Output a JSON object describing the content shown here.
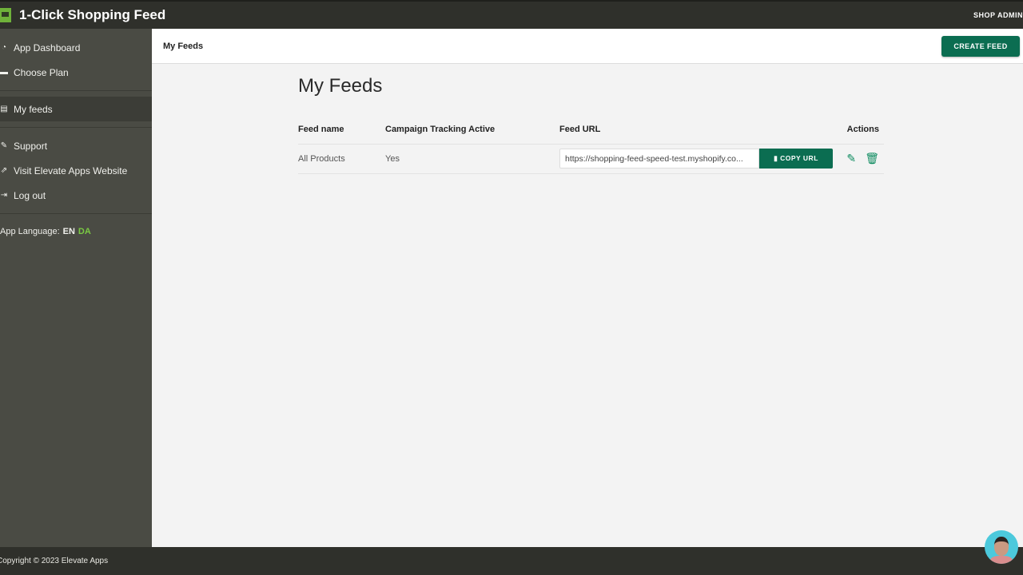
{
  "app": {
    "title": "1-Click Shopping Feed",
    "shop_admin_label": "SHOP ADMIN",
    "logo_icon": "shopping-cart-icon"
  },
  "sidebar": {
    "items": [
      {
        "label": "App Dashboard",
        "icon": "dashboard-icon",
        "glyph": "◔"
      },
      {
        "label": "Choose Plan",
        "icon": "credit-card-icon",
        "glyph": "▬"
      },
      {
        "label": "My feeds",
        "icon": "file-icon",
        "glyph": "▤",
        "active": true
      },
      {
        "label": "Support",
        "icon": "handshake-icon",
        "glyph": "✎"
      },
      {
        "label": "Visit Elevate Apps Website",
        "icon": "external-link-icon",
        "glyph": "⇗"
      },
      {
        "label": "Log out",
        "icon": "sign-out-icon",
        "glyph": "⇥"
      }
    ],
    "language": {
      "label": "App Language:",
      "current": "EN",
      "alternate": "DA",
      "accent_color": "#7ac943"
    }
  },
  "header": {
    "title": "My Feeds",
    "create_button": "CREATE FEED"
  },
  "main": {
    "page_title": "My Feeds",
    "table": {
      "columns": [
        "Feed name",
        "Campaign Tracking Active",
        "Feed URL",
        "Actions"
      ],
      "rows": [
        {
          "feed_name": "All Products",
          "tracking": "Yes",
          "feed_url": "https://shopping-feed-speed-test.myshopify.co...",
          "copy_label": "COPY URL"
        }
      ]
    }
  },
  "footer": {
    "copyright": "Copyright © 2023 Elevate Apps"
  },
  "colors": {
    "primary": "#0b6d51",
    "topbar": "#2f302b",
    "sidebar": "#4a4b44"
  }
}
